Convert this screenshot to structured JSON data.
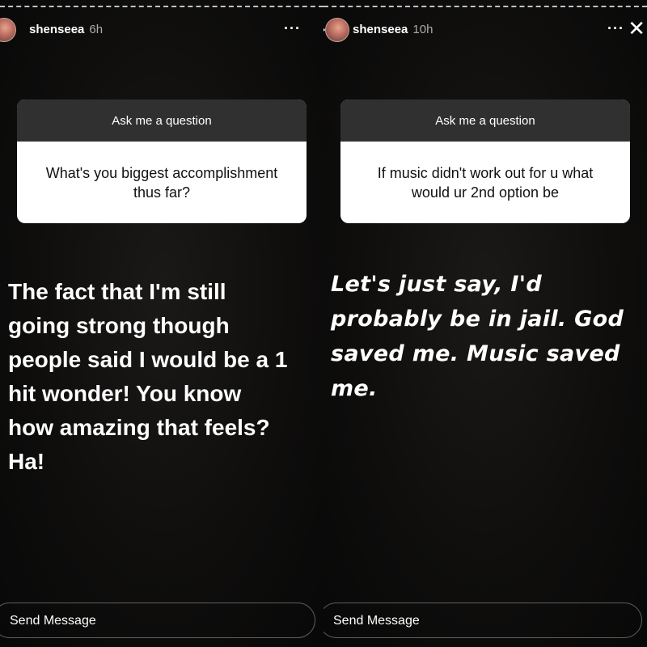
{
  "stories": [
    {
      "username": "shenseea",
      "time": "6h",
      "more_label": "···",
      "question_header": "Ask me a question",
      "question": "What's you biggest accomplishment thus far?",
      "answer": "The fact that I'm still\ngoing strong though\npeople said I would be a 1\nhit wonder! You know\nhow amazing that feels?\nHa!",
      "send_placeholder": "Send Message"
    },
    {
      "username": "shenseea",
      "time": "10h",
      "more_label": "···",
      "question_header": "Ask me a question",
      "question": "If music didn't work out for u what would ur 2nd option be",
      "answer": "Let's just say, I'd\nprobably be in jail. God\nsaved me. Music saved\nme.",
      "send_placeholder": "Send Message"
    }
  ],
  "icons": {
    "prev": "chevron-right-icon",
    "close": "close-icon",
    "more": "more-icon"
  }
}
